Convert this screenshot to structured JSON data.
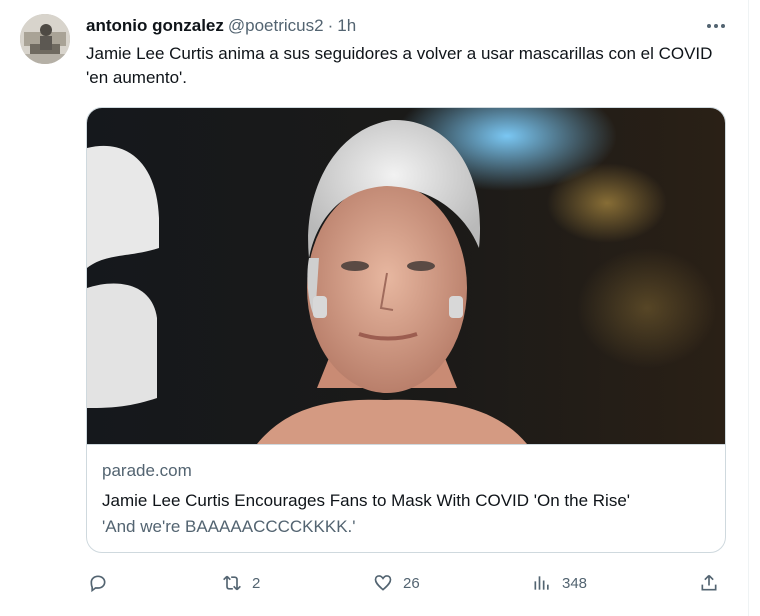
{
  "tweet": {
    "author_name": "antonio gonzalez",
    "author_handle": "@poetricus2",
    "separator": "·",
    "time": "1h",
    "text": "Jamie Lee Curtis anima a sus seguidores a volver a usar mascarillas con el COVID 'en aumento'.",
    "avatar_icon": "profile-photo",
    "more_icon": "more-horizontal-icon"
  },
  "card": {
    "domain": "parade.com",
    "title": "Jamie Lee Curtis Encourages Fans to Mask With COVID 'On the Rise'",
    "description": "'And we're BAAAAACCCCKKKK.'",
    "image_alt": "photo of woman with short silver hair"
  },
  "actions": {
    "reply": {
      "icon": "reply-icon",
      "count": ""
    },
    "retweet": {
      "icon": "retweet-icon",
      "count": "2"
    },
    "like": {
      "icon": "heart-icon",
      "count": "26"
    },
    "views": {
      "icon": "views-icon",
      "count": "348"
    },
    "share": {
      "icon": "share-icon",
      "count": ""
    }
  },
  "colors": {
    "text_primary": "#0f1419",
    "text_secondary": "#536471",
    "border": "#cfd9de"
  }
}
